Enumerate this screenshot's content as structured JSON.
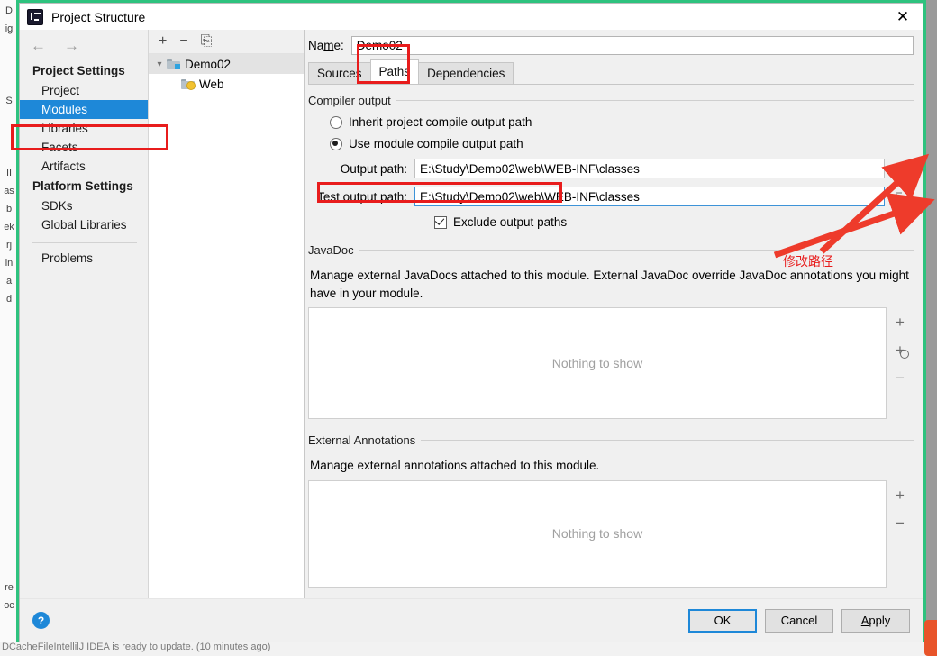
{
  "window": {
    "title": "Project Structure",
    "app_icon": "intellij-idea-logo-icon",
    "close_icon": "close-icon"
  },
  "background": {
    "left_strip_chars": [
      "D",
      "ig",
      "",
      "",
      "",
      "S",
      "",
      "",
      "",
      "II",
      "as",
      "b",
      "ek",
      "rj",
      "in",
      "a",
      "d",
      "",
      "",
      "",
      "",
      "",
      "",
      "",
      "",
      "",
      "",
      "",
      "",
      "",
      "",
      "",
      "re",
      "oc"
    ],
    "status_text": "DCacheFileIntellilJ  IDEA is ready to update. (10 minutes ago)"
  },
  "navigation": {
    "back_icon": "back-arrow-icon",
    "forward_icon": "forward-arrow-icon",
    "sections": [
      {
        "group": "Project Settings",
        "items": [
          {
            "label": "Project",
            "selected": false
          },
          {
            "label": "Modules",
            "selected": true
          },
          {
            "label": "Libraries",
            "selected": false
          },
          {
            "label": "Facets",
            "selected": false
          },
          {
            "label": "Artifacts",
            "selected": false
          }
        ]
      },
      {
        "group": "Platform Settings",
        "items": [
          {
            "label": "SDKs",
            "selected": false
          },
          {
            "label": "Global Libraries",
            "selected": false
          }
        ]
      }
    ],
    "problems_label": "Problems"
  },
  "tree": {
    "toolbar": [
      {
        "icon": "plus-icon",
        "glyph": "+"
      },
      {
        "icon": "minus-icon",
        "glyph": "−"
      },
      {
        "icon": "copy-icon",
        "glyph": "⎘"
      }
    ],
    "nodes": [
      {
        "label": "Demo02",
        "icon": "module-folder-icon",
        "expanded": true,
        "selected": true
      },
      {
        "label": "Web",
        "icon": "web-facet-icon",
        "expanded": false,
        "selected": false
      }
    ]
  },
  "module": {
    "name_label_pre": "Na",
    "name_label_mnemonic": "m",
    "name_label_post": "e:",
    "name_value": "Demo02",
    "tabs": [
      {
        "label": "Sources",
        "active": false
      },
      {
        "label": "Paths",
        "active": true
      },
      {
        "label": "Dependencies",
        "active": false
      }
    ]
  },
  "compiler_output": {
    "group_title": "Compiler output",
    "options": [
      {
        "label": "Inherit project compile output path",
        "selected": false
      },
      {
        "label": "Use module compile output path",
        "selected": true
      }
    ],
    "output_path_label": "Output path:",
    "output_path_value": "E:\\Study\\Demo02\\web\\WEB-INF\\classes",
    "test_output_path_label": "Test output path:",
    "test_output_path_value": "E:\\Study\\Demo02\\web\\WEB-INF\\classes",
    "browse_icon": "folder-browse-icon",
    "exclude_label": "Exclude output paths",
    "exclude_checked": true
  },
  "javadoc": {
    "group_title": "JavaDoc",
    "description": "Manage external JavaDocs attached to this module. External JavaDoc override JavaDoc annotations you might have in your module.",
    "empty_text": "Nothing to show",
    "tools": [
      {
        "icon": "add-icon",
        "glyph": "+"
      },
      {
        "icon": "add-url-icon",
        "glyph": "+"
      },
      {
        "icon": "remove-icon",
        "glyph": "−"
      }
    ]
  },
  "external_annotations": {
    "group_title": "External Annotations",
    "description": "Manage external annotations attached to this module.",
    "empty_text": "Nothing to show",
    "tools": [
      {
        "icon": "add-icon",
        "glyph": "+"
      },
      {
        "icon": "remove-icon",
        "glyph": "−"
      }
    ]
  },
  "footer": {
    "help_icon": "help-icon",
    "help_glyph": "?",
    "ok_label": "OK",
    "cancel_label": "Cancel",
    "apply_label_pre": "",
    "apply_label_mnemonic": "A",
    "apply_label_post": "pply"
  },
  "annotations": {
    "note_text": "修改路径",
    "color": "#e81c1c",
    "highlight_boxes": [
      "modules-nav-item",
      "paths-tab",
      "use-module-compile-output-path-radio"
    ],
    "arrow_targets": [
      "output-path-browse-button",
      "test-output-path-browse-button"
    ]
  },
  "colors": {
    "selection_blue": "#1e88d8",
    "annotation_red": "#e81c1c",
    "dialog_bg": "#f0f0f0",
    "focus_border": "#3d93d8",
    "green_frame": "#2ec27e"
  }
}
